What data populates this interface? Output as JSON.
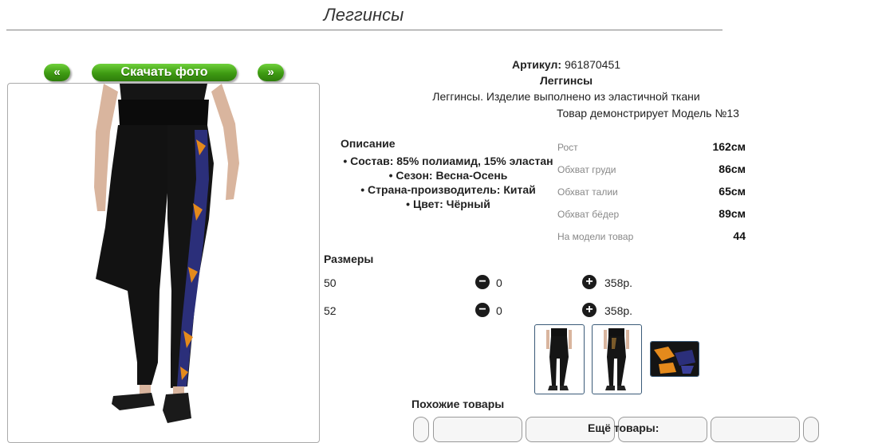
{
  "page": {
    "title": "Леггинсы"
  },
  "gallery": {
    "prev_label": "«",
    "download_label": "Скачать фото",
    "next_label": "»"
  },
  "product": {
    "sku_label": "Артикул:",
    "sku_value": "961870451",
    "name": "Леггинсы",
    "short_description": "Леггинсы. Изделие выполнено из эластичной ткани",
    "model_line": "Товар демонстрирует Модель №13"
  },
  "description": {
    "title": "Описание",
    "items": [
      "• Состав: 85% полиамид, 15% эластан",
      "• Сезон: Весна-Осень",
      "• Страна-производитель: Китай",
      "• Цвет: Чёрный"
    ]
  },
  "measurements": [
    {
      "label": "Рост",
      "value": "162см"
    },
    {
      "label": "Обхват груди",
      "value": "86см"
    },
    {
      "label": "Обхват талии",
      "value": "65см"
    },
    {
      "label": "Обхват бёдер",
      "value": "89см"
    },
    {
      "label": "На модели товар",
      "value": "44"
    }
  ],
  "sizes": {
    "title": "Размеры",
    "rows": [
      {
        "size": "50",
        "minus": "−",
        "qty": "0",
        "plus": "+",
        "price": "358р."
      },
      {
        "size": "52",
        "minus": "−",
        "qty": "0",
        "plus": "+",
        "price": "358р."
      }
    ]
  },
  "similar": {
    "title": "Похожие товары"
  },
  "more": {
    "title": "Ещё товары:"
  },
  "colors": {
    "button_green": "#3e9a12",
    "thumb_border": "#3a5a78"
  }
}
